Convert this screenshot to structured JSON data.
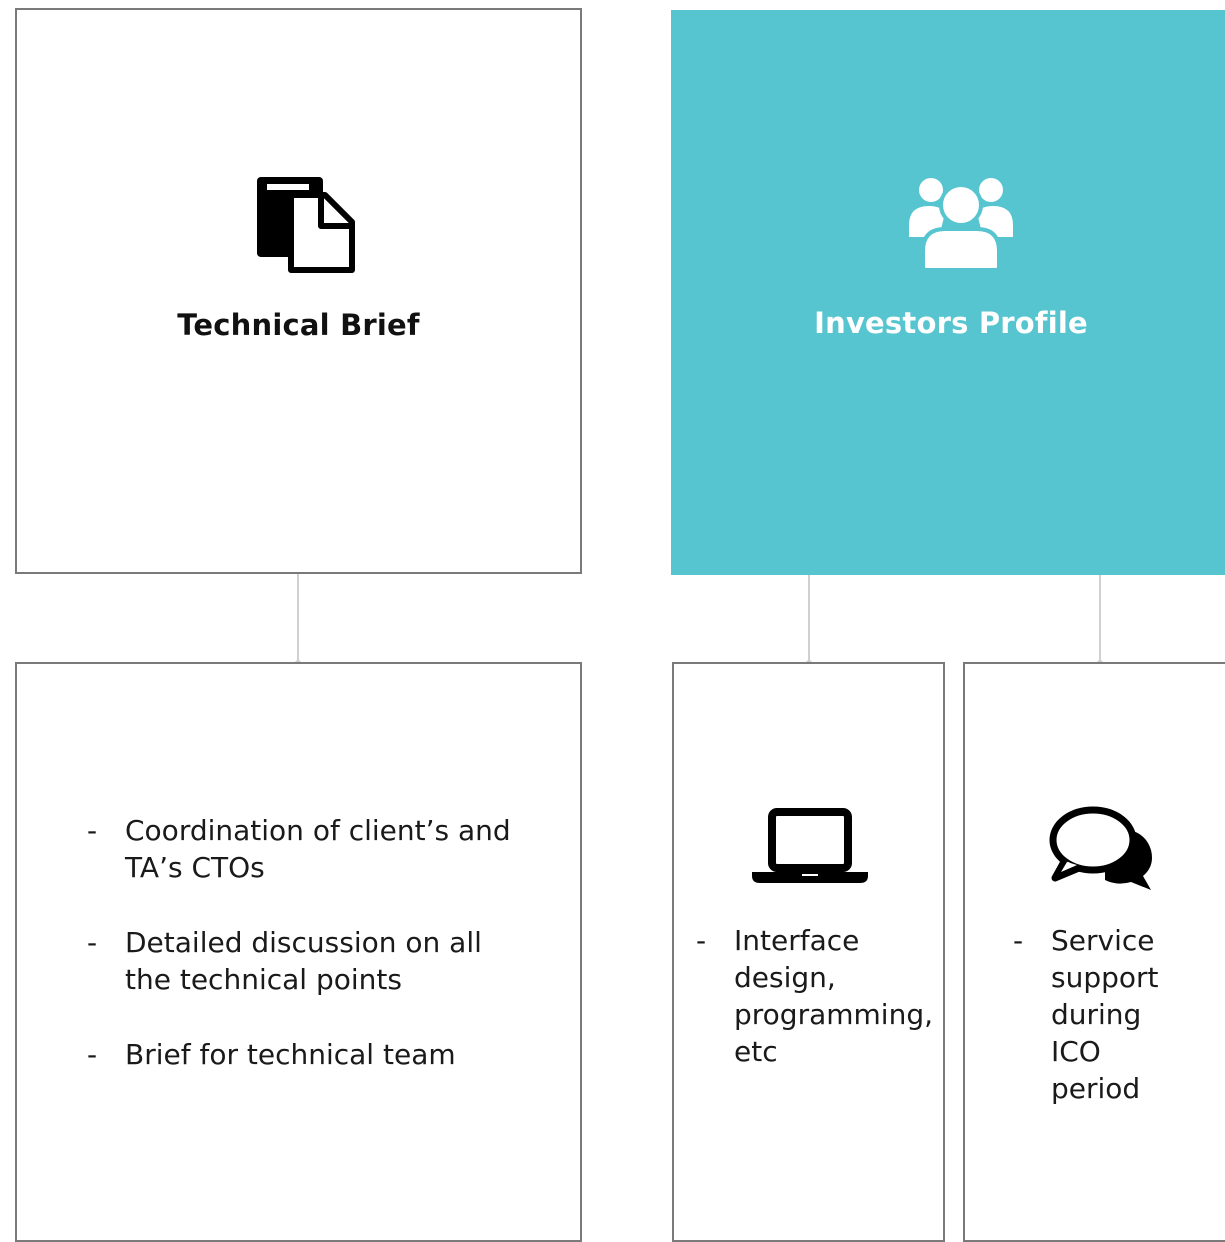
{
  "colors": {
    "accent_teal": "#56c5cf",
    "border_gray": "#7a7a7a",
    "connector_gray": "#d0d0d0",
    "text_dark": "#111111",
    "text_on_accent": "#ffffff"
  },
  "technical_brief": {
    "icon": "document-icon",
    "title": "Technical Brief",
    "details": [
      "Coordination of client’s and TA’s CTOs",
      "Detailed discussion on all the technical points",
      "Brief for technical team"
    ]
  },
  "investors_profile": {
    "icon": "users-group-icon",
    "title": "Investors Profile",
    "branches": [
      {
        "icon": "laptop-icon",
        "items": [
          "Interface design, programming, etc"
        ]
      },
      {
        "icon": "chat-bubbles-icon",
        "items": [
          "Service support during ICO period"
        ]
      }
    ]
  }
}
